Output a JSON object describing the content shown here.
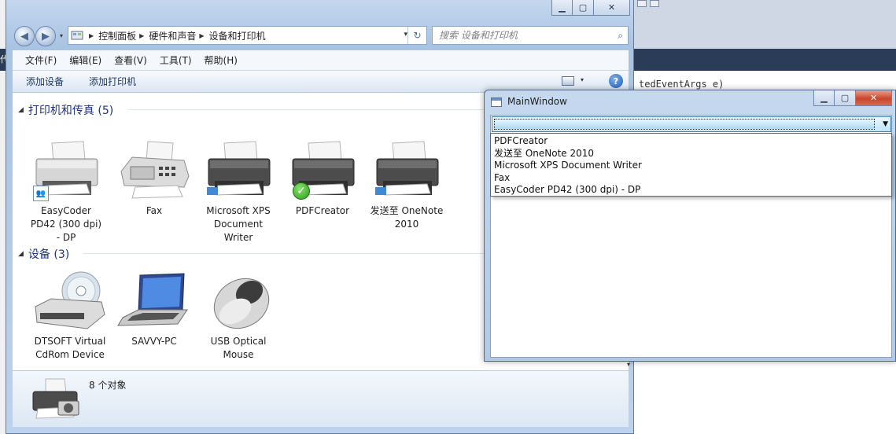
{
  "explorer": {
    "caption": {
      "minimize": "▁",
      "maximize": "▢",
      "close": "✕"
    },
    "nav": {
      "back_glyph": "◀",
      "forward_glyph": "▶",
      "dropdown_glyph": "▾"
    },
    "breadcrumbs": [
      "控制面板",
      "硬件和声音",
      "设备和打印机"
    ],
    "crumb_separator": "▶",
    "address_dropdown_glyph": "▾",
    "refresh_glyph": "↻",
    "search": {
      "placeholder": "搜索 设备和打印机",
      "value": "",
      "icon_glyph": "⌕"
    },
    "menu": [
      "文件(F)",
      "编辑(E)",
      "查看(V)",
      "工具(T)",
      "帮助(H)"
    ],
    "commands": [
      "添加设备",
      "添加打印机"
    ],
    "view_dropdown_glyph": "▾",
    "help_glyph": "?",
    "groups": [
      {
        "title": "打印机和传真 (5)",
        "items": [
          {
            "label_lines": [
              "EasyCoder",
              "PD42 (300 dpi)",
              "- DP"
            ],
            "icon": "printer-icon",
            "badge": "shared"
          },
          {
            "label_lines": [
              "Fax"
            ],
            "icon": "fax-icon",
            "badge": ""
          },
          {
            "label_lines": [
              "Microsoft XPS",
              "Document",
              "Writer"
            ],
            "icon": "printer-icon",
            "badge": ""
          },
          {
            "label_lines": [
              "PDFCreator"
            ],
            "icon": "printer-icon",
            "badge": "default"
          },
          {
            "label_lines": [
              "发送至 OneNote",
              "2010"
            ],
            "icon": "printer-icon",
            "badge": ""
          }
        ]
      },
      {
        "title": "设备 (3)",
        "items": [
          {
            "label_lines": [
              "DTSOFT Virtual",
              "CdRom Device"
            ],
            "icon": "cdrom-drive-icon"
          },
          {
            "label_lines": [
              "SAVVY-PC"
            ],
            "icon": "laptop-icon"
          },
          {
            "label_lines": [
              "USB Optical",
              "Mouse"
            ],
            "icon": "mouse-icon"
          }
        ]
      }
    ],
    "group_toggle_glyph": "◢",
    "details": {
      "count": "8 个对象",
      "icon": "printer-camera-icon"
    },
    "scroll_down_glyph": "▾"
  },
  "background_ide": {
    "code_fragment": "tedEventArgs e)",
    "edge_char": "代"
  },
  "mainwindow": {
    "title": "MainWindow",
    "caption": {
      "minimize": "▁",
      "maximize": "▢",
      "close": "✕"
    },
    "combo": {
      "selected": "",
      "arrow_glyph": "▼"
    },
    "dropdown_items": [
      "PDFCreator",
      "发送至 OneNote 2010",
      "Microsoft XPS Document Writer",
      "Fax",
      "EasyCoder PD42 (300 dpi) - DP"
    ]
  },
  "colors": {
    "group_title": "#1e3287",
    "aero_frame": "#b1c9e5",
    "ide_dark": "#2b3c59",
    "default_badge": "#2a9a1a"
  }
}
